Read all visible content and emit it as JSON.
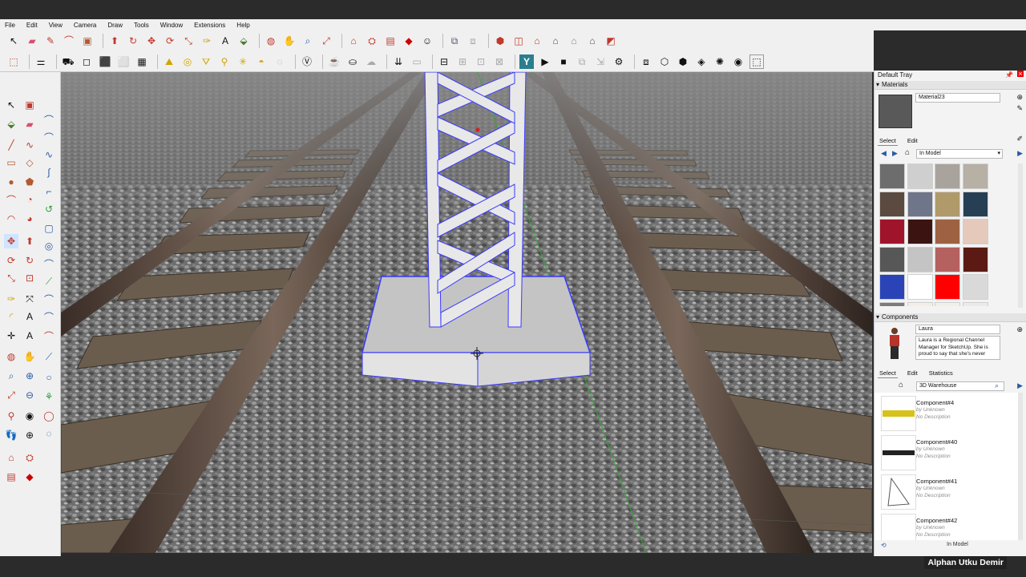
{
  "menu": [
    "File",
    "Edit",
    "View",
    "Camera",
    "Draw",
    "Tools",
    "Window",
    "Extensions",
    "Help"
  ],
  "toolbar_icons": {
    "row1": [
      "select-arrow-icon",
      "eraser-icon",
      "pencil-line-icon",
      "arc-icon",
      "rectangle-icon",
      "push-pull-icon",
      "follow-me-icon",
      "move-icon",
      "rotate-icon",
      "scale-icon",
      "tape-measure-icon",
      "text-icon",
      "paint-bucket-icon",
      "orbit-icon",
      "pan-icon",
      "zoom-icon",
      "zoom-extents-icon",
      "warehouse-icon",
      "extension-warehouse-icon",
      "sendto-layout-icon",
      "ruby-icon",
      "user-icon",
      "section-plane-icon",
      "section-display-icon",
      "iso-view-icon",
      "top-view-icon",
      "front-view-icon",
      "right-view-icon",
      "back-view-icon",
      "left-view-icon",
      "bottom-view-icon"
    ],
    "row2": [
      "add-location-icon",
      "axes-icon",
      "xray-icon",
      "wireframe-icon",
      "hidden-line-icon",
      "shaded-icon",
      "shaded-textures-icon",
      "monochrome-icon",
      "sandbox-from-contours-icon",
      "sandbox-scratch-icon",
      "smoove-icon",
      "stamp-icon",
      "drape-icon",
      "add-detail-icon",
      "flip-edge-icon",
      "solid-union-icon",
      "solid-subtract-icon",
      "solid-trim-icon",
      "solid-split-icon",
      "outer-shell-icon",
      "intersect-icon",
      "v-ray-icon",
      "play-icon",
      "stop-icon",
      "export-icon",
      "settings-gear-icon",
      "component-icon",
      "group-icon",
      "cube-outline-icon",
      "cube-solid-icon",
      "sphere-icon",
      "lasso-icon",
      "box-select-icon"
    ]
  },
  "tray": {
    "title": "Default Tray",
    "materials": {
      "header": "Materials",
      "name": "Material23",
      "tab_select": "Select",
      "tab_edit": "Edit",
      "library": "In Model",
      "swatch_colors": [
        "#6d6d6d",
        "#cfcfcf",
        "#a9a39d",
        "#b7b0a4",
        "#5b4a3f",
        "#6f7689",
        "#b19a6a",
        "#273f55",
        "#a0142b",
        "#3b1411",
        "#9e6242",
        "#e5c9bb",
        "#575757",
        "#c4c4c4",
        "#b5615f",
        "#5b1b14",
        "#2a44b8",
        "#ffffff",
        "#ff0000",
        "#d9d9d9",
        "#7c7c7c",
        "#f4ede3",
        "#f2efe8",
        "#eaeaea"
      ]
    },
    "components": {
      "header": "Components",
      "name": "Laura",
      "description": "Laura is a Regional Channel Manager for SketchUp. She is proud to say that she's never",
      "tab_select": "Select",
      "tab_edit": "Edit",
      "tab_statistics": "Statistics",
      "source": "3D Warehouse",
      "items": [
        {
          "title": "Component#4",
          "by": "by",
          "author": "Unknown",
          "desc": "No Description"
        },
        {
          "title": "Component#40",
          "by": "by",
          "author": "Unknown",
          "desc": "No Description"
        },
        {
          "title": "Component#41",
          "by": "by",
          "author": "Unknown",
          "desc": "No Description"
        },
        {
          "title": "Component#42",
          "by": "by",
          "author": "Unknown",
          "desc": "No Description"
        }
      ],
      "footer_library": "In Model"
    }
  },
  "watermark": "Alphan Utku Demir",
  "viewport": {
    "label": "3D model viewport",
    "colors": {
      "gravel": "#7a7a7a",
      "sleeper": "#6b5d4e",
      "rail": "#5a4a40",
      "selection": "#3b3bff"
    }
  }
}
